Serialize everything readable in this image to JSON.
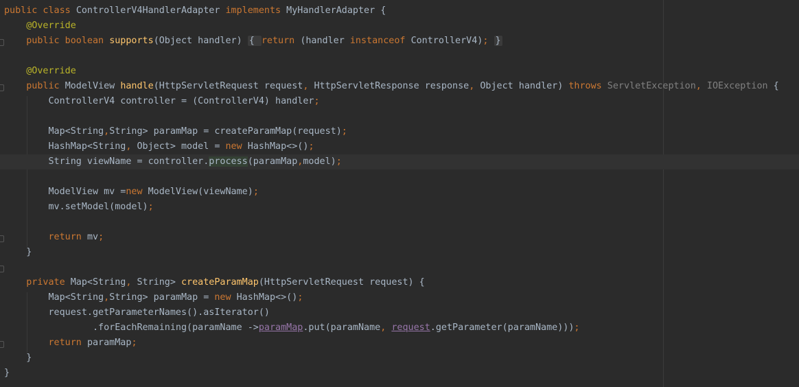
{
  "editor": {
    "language": "java",
    "class_name": "ControllerV4HandlerAdapter",
    "interface_name": "MyHandlerAdapter"
  },
  "colors": {
    "background": "#2b2b2b",
    "text": "#a9b7c6",
    "keyword": "#cc7832",
    "annotation": "#bbb529",
    "method_declaration": "#ffc66d",
    "muted_exception": "#808080",
    "field_reference": "#9876aa",
    "current_line": "#323232"
  },
  "lines": [
    [
      {
        "t": "public class ",
        "c": "kw"
      },
      {
        "t": "ControllerV4HandlerAdapter "
      },
      {
        "t": "implements ",
        "c": "kw"
      },
      {
        "t": "MyHandlerAdapter {"
      }
    ],
    [
      {
        "t": "    "
      },
      {
        "t": "@Override",
        "c": "ann"
      }
    ],
    [
      {
        "t": "    "
      },
      {
        "t": "public boolean ",
        "c": "kw"
      },
      {
        "t": "supports",
        "c": "fn"
      },
      {
        "t": "(Object handler) "
      },
      {
        "t": "{ ",
        "c": "brace"
      },
      {
        "t": "return ",
        "c": "kw"
      },
      {
        "t": "(handler "
      },
      {
        "t": "instanceof ",
        "c": "kw"
      },
      {
        "t": "ControllerV4)"
      },
      {
        "t": "; ",
        "c": "kw"
      },
      {
        "t": "}",
        "c": "brace"
      }
    ],
    [],
    [
      {
        "t": "    "
      },
      {
        "t": "@Override",
        "c": "ann"
      }
    ],
    [
      {
        "t": "    "
      },
      {
        "t": "public ",
        "c": "kw"
      },
      {
        "t": "ModelView "
      },
      {
        "t": "handle",
        "c": "fn"
      },
      {
        "t": "(HttpServletRequest request"
      },
      {
        "t": ", ",
        "c": "kw"
      },
      {
        "t": "HttpServletResponse response"
      },
      {
        "t": ", ",
        "c": "kw"
      },
      {
        "t": "Object handler) "
      },
      {
        "t": "throws ",
        "c": "kw"
      },
      {
        "t": "ServletException",
        "c": "gray"
      },
      {
        "t": ", ",
        "c": "kw"
      },
      {
        "t": "IOException",
        "c": "gray"
      },
      {
        "t": " {"
      }
    ],
    [
      {
        "t": "        ControllerV4 controller = (ControllerV4) handler"
      },
      {
        "t": ";",
        "c": "kw"
      }
    ],
    [],
    [
      {
        "t": "        Map<String"
      },
      {
        "t": ",",
        "c": "kw"
      },
      {
        "t": "String> paramMap = createParamMap(request)"
      },
      {
        "t": ";",
        "c": "kw"
      }
    ],
    [
      {
        "t": "        HashMap<String"
      },
      {
        "t": ", ",
        "c": "kw"
      },
      {
        "t": "Object> model = "
      },
      {
        "t": "new ",
        "c": "kw"
      },
      {
        "t": "HashMap<>()"
      },
      {
        "t": ";",
        "c": "kw"
      }
    ],
    [
      {
        "t": "        String viewName = controller."
      },
      {
        "t": "process",
        "c": "hl"
      },
      {
        "t": "(paramMap"
      },
      {
        "t": ",",
        "c": "kw"
      },
      {
        "t": "model)"
      },
      {
        "t": ";",
        "c": "kw"
      }
    ],
    [],
    [
      {
        "t": "        ModelView mv ="
      },
      {
        "t": "new ",
        "c": "kw"
      },
      {
        "t": "ModelView(viewName)"
      },
      {
        "t": ";",
        "c": "kw"
      }
    ],
    [
      {
        "t": "        mv.setModel(model)"
      },
      {
        "t": ";",
        "c": "kw"
      }
    ],
    [],
    [
      {
        "t": "        "
      },
      {
        "t": "return ",
        "c": "kw"
      },
      {
        "t": "mv"
      },
      {
        "t": ";",
        "c": "kw"
      }
    ],
    [
      {
        "t": "    }"
      }
    ],
    [],
    [
      {
        "t": "    "
      },
      {
        "t": "private ",
        "c": "kw"
      },
      {
        "t": "Map<String"
      },
      {
        "t": ", ",
        "c": "kw"
      },
      {
        "t": "String> "
      },
      {
        "t": "createParamMap",
        "c": "fn"
      },
      {
        "t": "(HttpServletRequest request) {"
      }
    ],
    [
      {
        "t": "        Map<String"
      },
      {
        "t": ",",
        "c": "kw"
      },
      {
        "t": "String> paramMap = "
      },
      {
        "t": "new ",
        "c": "kw"
      },
      {
        "t": "HashMap<>()"
      },
      {
        "t": ";",
        "c": "kw"
      }
    ],
    [
      {
        "t": "        request.getParameterNames().asIterator()"
      }
    ],
    [
      {
        "t": "                .forEachRemaining(paramName ->"
      },
      {
        "t": "paramMap",
        "c": "fieldref"
      },
      {
        "t": ".put(paramName"
      },
      {
        "t": ", ",
        "c": "kw"
      },
      {
        "t": "request",
        "c": "fieldref"
      },
      {
        "t": ".getParameter(paramName)))"
      },
      {
        "t": ";",
        "c": "kw"
      }
    ],
    [
      {
        "t": "        "
      },
      {
        "t": "return ",
        "c": "kw"
      },
      {
        "t": "paramMap"
      },
      {
        "t": ";",
        "c": "kw"
      }
    ],
    [
      {
        "t": "    }"
      }
    ],
    [
      {
        "t": "}"
      }
    ]
  ]
}
